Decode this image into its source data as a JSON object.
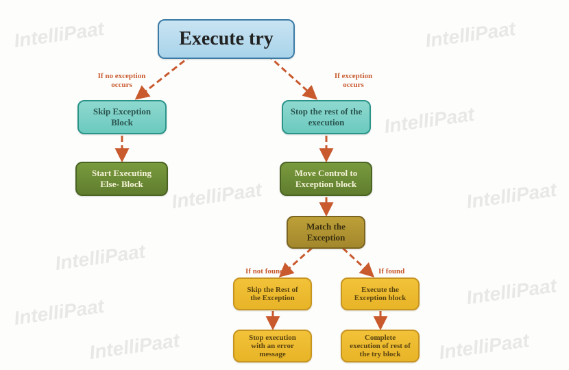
{
  "watermark_text": "IntelliPaat",
  "nodes": {
    "root": "Execute try",
    "left1": "Skip Exception Block",
    "left2": "Start Executing Else- Block",
    "right1": "Stop the rest of the execution",
    "right2": "Move Control to Exception block",
    "right3": "Match the Exception",
    "leaf_l1": "Skip the Rest of the Exception",
    "leaf_l2": "Stop execution with an error message",
    "leaf_r1": "Execute the Exception block",
    "leaf_r2": "Complete execution of rest of the try block"
  },
  "labels": {
    "no_exc": "If no exception occurs",
    "exc": "If exception occurs",
    "not_found": "If not found",
    "found": "If found"
  },
  "colors": {
    "arrow": "#c85a2e"
  }
}
